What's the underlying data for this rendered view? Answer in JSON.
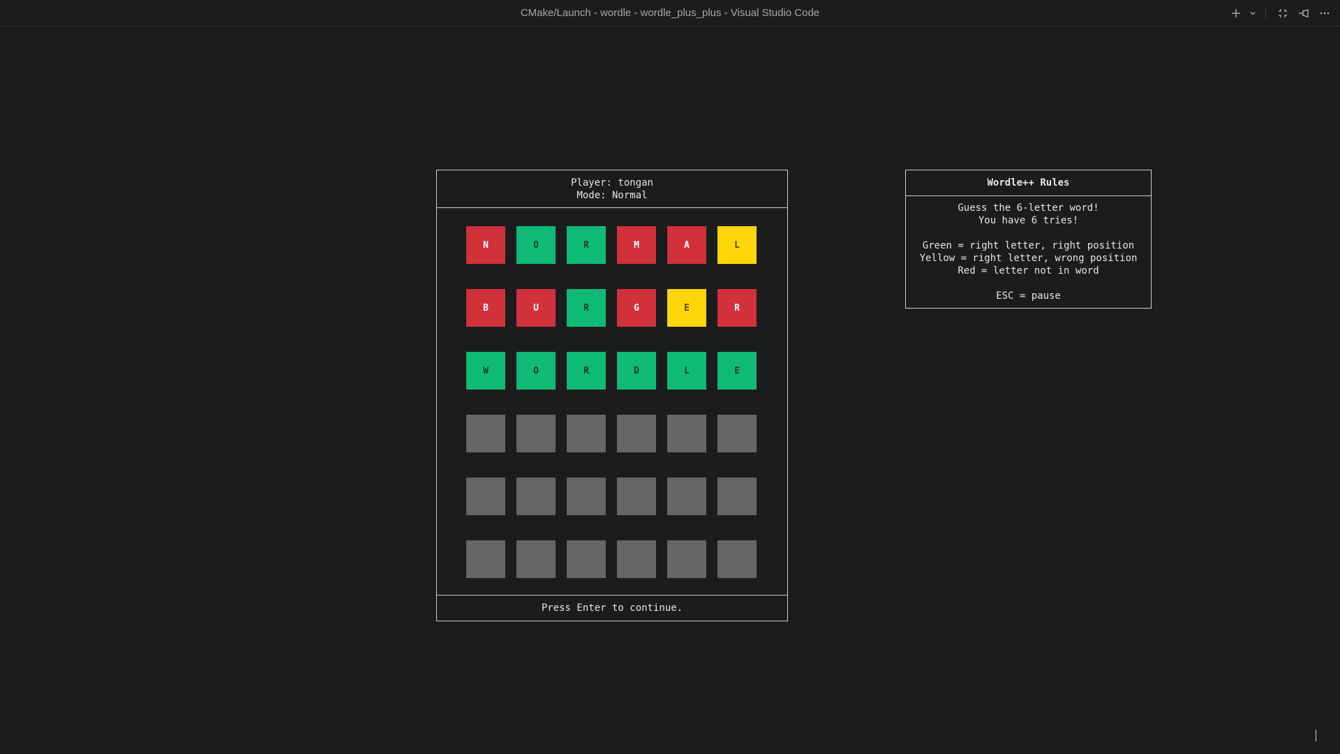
{
  "window": {
    "title": "CMake/Launch - wordle - wordle_plus_plus - Visual Studio Code",
    "icons": [
      "plus-icon",
      "chevron-down-icon",
      "minimize-panel-icon",
      "pin-icon",
      "more-icon"
    ]
  },
  "board": {
    "player_line": "Player: tongan",
    "mode_line": "Mode: Normal",
    "rows": [
      [
        {
          "letter": "N",
          "state": "red"
        },
        {
          "letter": "O",
          "state": "green"
        },
        {
          "letter": "R",
          "state": "green"
        },
        {
          "letter": "M",
          "state": "red"
        },
        {
          "letter": "A",
          "state": "red"
        },
        {
          "letter": "L",
          "state": "yellow"
        }
      ],
      [
        {
          "letter": "B",
          "state": "red"
        },
        {
          "letter": "U",
          "state": "red"
        },
        {
          "letter": "R",
          "state": "green"
        },
        {
          "letter": "G",
          "state": "red"
        },
        {
          "letter": "E",
          "state": "yellow"
        },
        {
          "letter": "R",
          "state": "red"
        }
      ],
      [
        {
          "letter": "W",
          "state": "green"
        },
        {
          "letter": "O",
          "state": "green"
        },
        {
          "letter": "R",
          "state": "green"
        },
        {
          "letter": "D",
          "state": "green"
        },
        {
          "letter": "L",
          "state": "green"
        },
        {
          "letter": "E",
          "state": "green"
        }
      ],
      [
        {
          "letter": "",
          "state": "empty"
        },
        {
          "letter": "",
          "state": "empty"
        },
        {
          "letter": "",
          "state": "empty"
        },
        {
          "letter": "",
          "state": "empty"
        },
        {
          "letter": "",
          "state": "empty"
        },
        {
          "letter": "",
          "state": "empty"
        }
      ],
      [
        {
          "letter": "",
          "state": "empty"
        },
        {
          "letter": "",
          "state": "empty"
        },
        {
          "letter": "",
          "state": "empty"
        },
        {
          "letter": "",
          "state": "empty"
        },
        {
          "letter": "",
          "state": "empty"
        },
        {
          "letter": "",
          "state": "empty"
        }
      ],
      [
        {
          "letter": "",
          "state": "empty"
        },
        {
          "letter": "",
          "state": "empty"
        },
        {
          "letter": "",
          "state": "empty"
        },
        {
          "letter": "",
          "state": "empty"
        },
        {
          "letter": "",
          "state": "empty"
        },
        {
          "letter": "",
          "state": "empty"
        }
      ]
    ],
    "footer": "Press Enter to continue."
  },
  "rules": {
    "title": "Wordle++ Rules",
    "line1": "Guess the 6-letter word!",
    "line2": "You have 6 tries!",
    "green_rule": "Green = right letter, right position",
    "yellow_rule": "Yellow = right letter, wrong position",
    "red_rule": "Red = letter not in word",
    "esc_rule": "ESC = pause"
  },
  "colors": {
    "background": "#1b1c1e",
    "green": "#0fba77",
    "red": "#d0313a",
    "yellow": "#ffd60a",
    "empty": "#666666"
  }
}
